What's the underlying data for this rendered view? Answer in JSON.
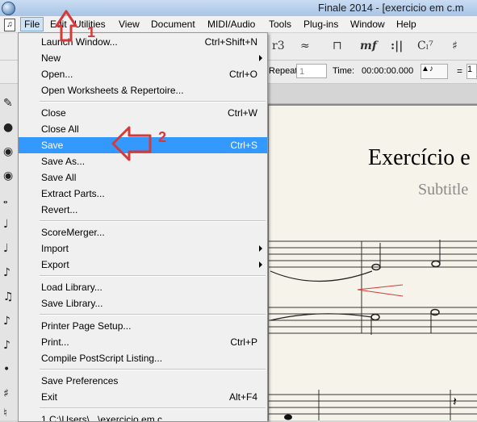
{
  "titlebar": {
    "title": "Finale 2014 - [exercicio em c.m"
  },
  "menubar": {
    "items": [
      "File",
      "Edit",
      "Utilities",
      "View",
      "Document",
      "MIDI/Audio",
      "Tools",
      "Plug-ins",
      "Window",
      "Help"
    ]
  },
  "toolbar": {
    "items": [
      "r3",
      "mf",
      "Cₗ⁷"
    ]
  },
  "playback": {
    "repeat_label": "Repeat:",
    "repeat_value": "1",
    "time_label": "Time:",
    "time_value": "00:00:00.000",
    "eq": "=",
    "tempo_value": "1"
  },
  "score": {
    "title": "Exercício e",
    "subtitle": "Subtitle"
  },
  "file_menu": {
    "items": [
      {
        "label": "Launch Window...",
        "shortcut": "Ctrl+Shift+N"
      },
      {
        "label": "New",
        "submenu": true
      },
      {
        "label": "Open...",
        "shortcut": "Ctrl+O"
      },
      {
        "label": "Open Worksheets & Repertoire..."
      },
      {
        "label": "Close",
        "shortcut": "Ctrl+W"
      },
      {
        "label": "Close All"
      },
      {
        "label": "Save",
        "shortcut": "Ctrl+S",
        "highlighted": true
      },
      {
        "label": "Save As..."
      },
      {
        "label": "Save All"
      },
      {
        "label": "Extract Parts..."
      },
      {
        "label": "Revert..."
      },
      {
        "label": "ScoreMerger..."
      },
      {
        "label": "Import",
        "submenu": true
      },
      {
        "label": "Export",
        "submenu": true
      },
      {
        "label": "Load Library..."
      },
      {
        "label": "Save Library..."
      },
      {
        "label": "Printer Page Setup..."
      },
      {
        "label": "Print...",
        "shortcut": "Ctrl+P"
      },
      {
        "label": "Compile PostScript Listing..."
      },
      {
        "label": "Save Preferences"
      },
      {
        "label": "Exit",
        "shortcut": "Alt+F4"
      },
      {
        "label": "1 C:\\Users\\...\\exercicio em c"
      }
    ]
  },
  "annotations": {
    "step1": "1",
    "step2": "2",
    "color": "#d43a3a"
  },
  "colors": {
    "highlight": "#3399ff",
    "menu_bg": "#f0f0f0",
    "page_bg": "#f6f3ea"
  }
}
